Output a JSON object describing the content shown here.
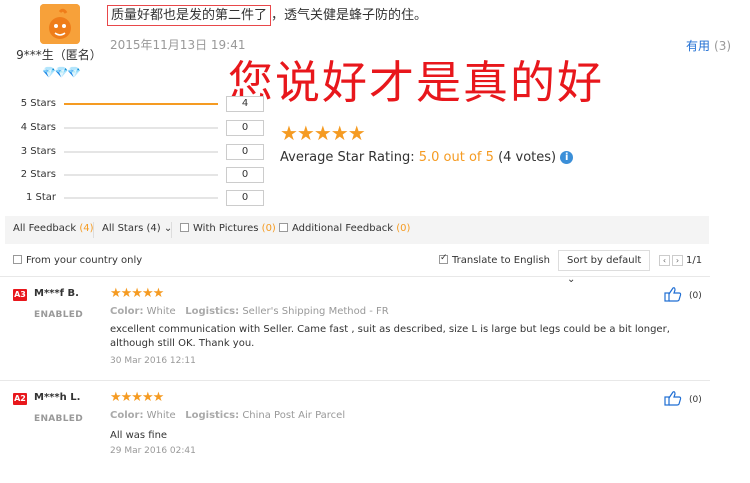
{
  "top_review": {
    "text_highlight": "质量好都也是发的第二件了",
    "text_rest": "，透气关健是蜂子防的住。",
    "date": "2015年11月13日 19:41",
    "useful_label": "有用",
    "useful_count": "(3)",
    "user_name": "9***生（匿名）",
    "user_level": "💎💎💎",
    "avatar_icon": "cartoon-avatar-icon"
  },
  "overlay_text": "您说好才是真的好",
  "histogram": {
    "rows": [
      {
        "label": "5 Stars",
        "count": "4",
        "fraction": 1.0
      },
      {
        "label": "4 Stars",
        "count": "0",
        "fraction": 0
      },
      {
        "label": "3 Stars",
        "count": "0",
        "fraction": 0
      },
      {
        "label": "2 Stars",
        "count": "0",
        "fraction": 0
      },
      {
        "label": "1 Star",
        "count": "0",
        "fraction": 0
      }
    ]
  },
  "rating": {
    "stars": "★★★★★",
    "label": "Average Star Rating:",
    "value": "5.0 out of 5",
    "votes": "(4 votes)",
    "info_icon": "i"
  },
  "filters": {
    "all_feedback": "All Feedback",
    "all_feedback_count": "(4)",
    "all_stars": "All Stars (4)",
    "with_pictures": "With Pictures",
    "with_pictures_count": "(0)",
    "additional": "Additional Feedback",
    "additional_count": "(0)",
    "from_country": "From your country only",
    "translate": "Translate to English",
    "sort": "Sort by default",
    "page": "1/1",
    "prev": "‹",
    "next": "›"
  },
  "reviews": [
    {
      "badge": "A3",
      "name": "M***f B.",
      "status": "ENABLED",
      "stars": "★★★★★",
      "color_label": "Color:",
      "color": "White",
      "logistics_label": "Logistics:",
      "logistics": "Seller's Shipping Method - FR",
      "text": "excellent communication with Seller. Came fast , suit as described, size L is large but legs could be a bit longer, although still OK. Thank you.",
      "date": "30 Mar 2016 12:11",
      "likes": "(0)"
    },
    {
      "badge": "A2",
      "name": "M***h L.",
      "status": "ENABLED",
      "stars": "★★★★★",
      "color_label": "Color:",
      "color": "White",
      "logistics_label": "Logistics:",
      "logistics": "China Post Air Parcel",
      "text": "All was fine",
      "date": "29 Mar 2016 02:41",
      "likes": "(0)"
    }
  ],
  "colors": {
    "accent": "#f59b22",
    "red": "#e8171c",
    "link": "#1f6ed3"
  }
}
